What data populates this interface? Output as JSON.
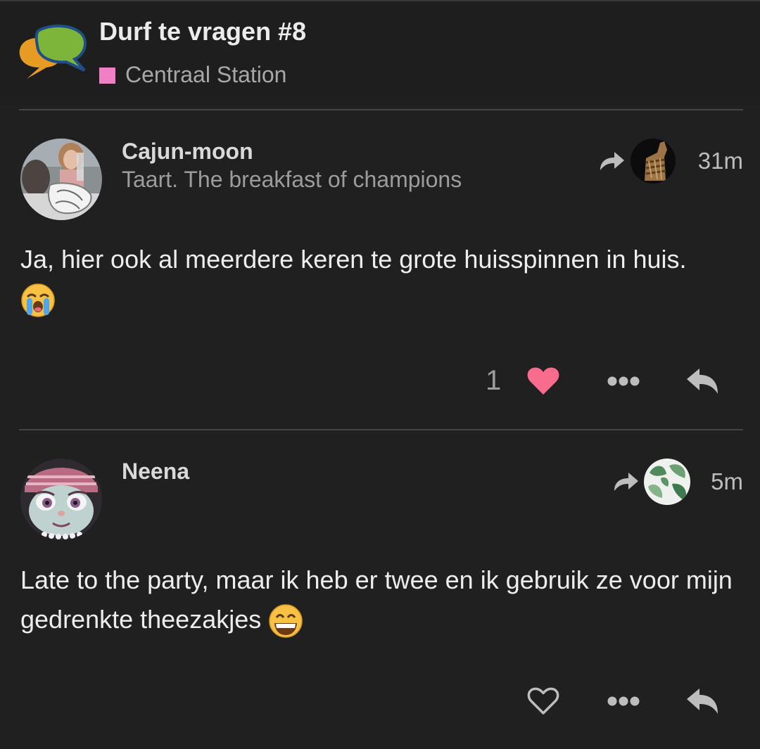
{
  "header": {
    "topic_title": "Durf te vragen #8",
    "category": {
      "name": "Centraal Station",
      "color": "#f07fc5"
    }
  },
  "posts": [
    {
      "username": "Cajun-moon",
      "user_title": "Taart. The breakfast of champions",
      "time": "31m",
      "body": "Ja, hier ook al meerdere keren te grote huisspinnen in huis.",
      "emoji": "crying-face",
      "like_count": "1",
      "liked": true
    },
    {
      "username": "Neena",
      "user_title": "",
      "time": "5m",
      "body": "Late to the party, maar ik heb er twee en ik gebruik ze voor mijn gedrenkte theezakjes",
      "emoji": "grinning-face",
      "like_count": "",
      "liked": false
    }
  ],
  "colors": {
    "heart_active": "#fa6c8d",
    "background": "#202020"
  }
}
